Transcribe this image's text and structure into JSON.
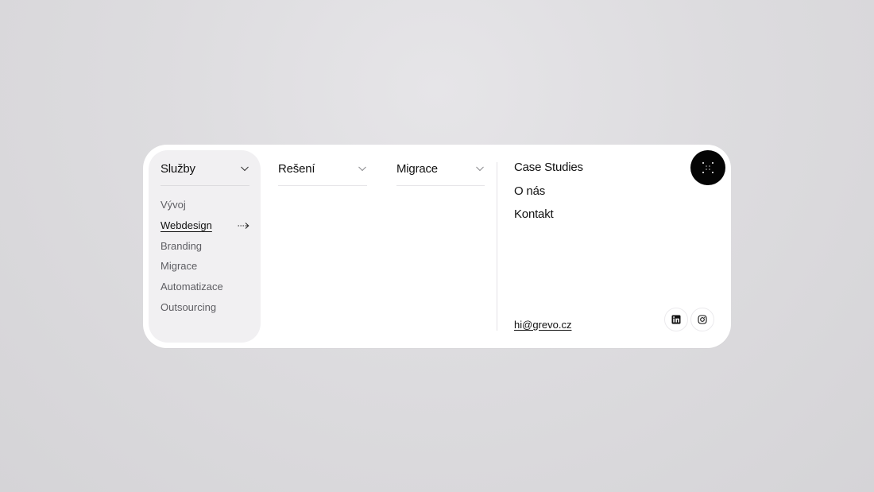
{
  "nav": {
    "columns": [
      {
        "label": "Služby",
        "expanded": true,
        "items": [
          {
            "label": "Vývoj"
          },
          {
            "label": "Webdesign",
            "active": true
          },
          {
            "label": "Branding"
          },
          {
            "label": "Migrace"
          },
          {
            "label": "Automatizace"
          },
          {
            "label": "Outsourcing"
          }
        ]
      },
      {
        "label": "Rešení",
        "expanded": false
      },
      {
        "label": "Migrace",
        "expanded": false
      }
    ],
    "links": [
      "Case Studies",
      "O nás",
      "Kontakt"
    ],
    "email": "hi@grevo.cz",
    "social": [
      {
        "name": "linkedin-icon"
      },
      {
        "name": "instagram-icon"
      }
    ],
    "menu_button_icon": "dots-grid-icon"
  },
  "colors": {
    "panel": "#ffffff",
    "active_column": "#f1f0f2",
    "button": "#050505",
    "text": "#111111",
    "muted_text": "#5e5e63"
  }
}
